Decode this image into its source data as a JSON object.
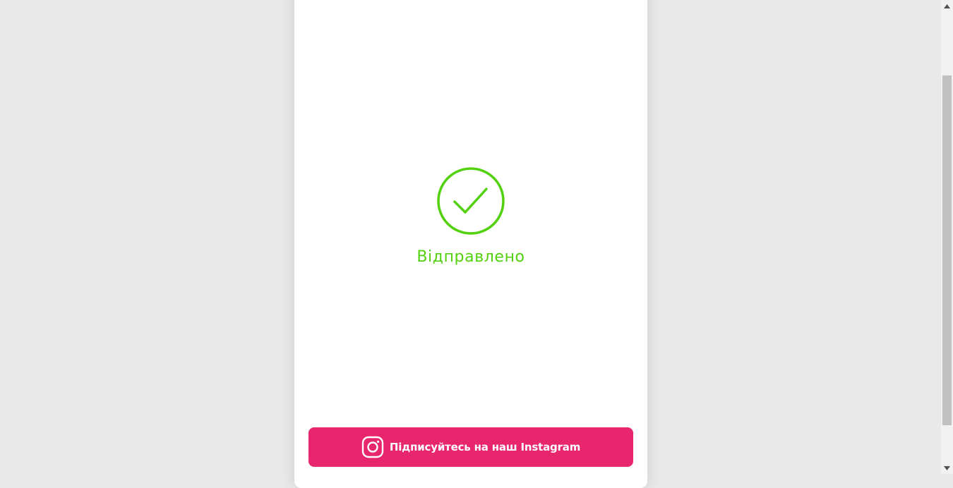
{
  "confirmation": {
    "status_text": "Відправлено",
    "status_color": "#53d10f",
    "icon": "check-circle-icon"
  },
  "instagram_button": {
    "label": "Підписуйтесь на наш Instagram",
    "icon": "instagram-icon",
    "background_color": "#e8266d"
  },
  "scrollbar": {
    "up_icon": "arrow-up-icon",
    "down_icon": "arrow-down-icon"
  }
}
